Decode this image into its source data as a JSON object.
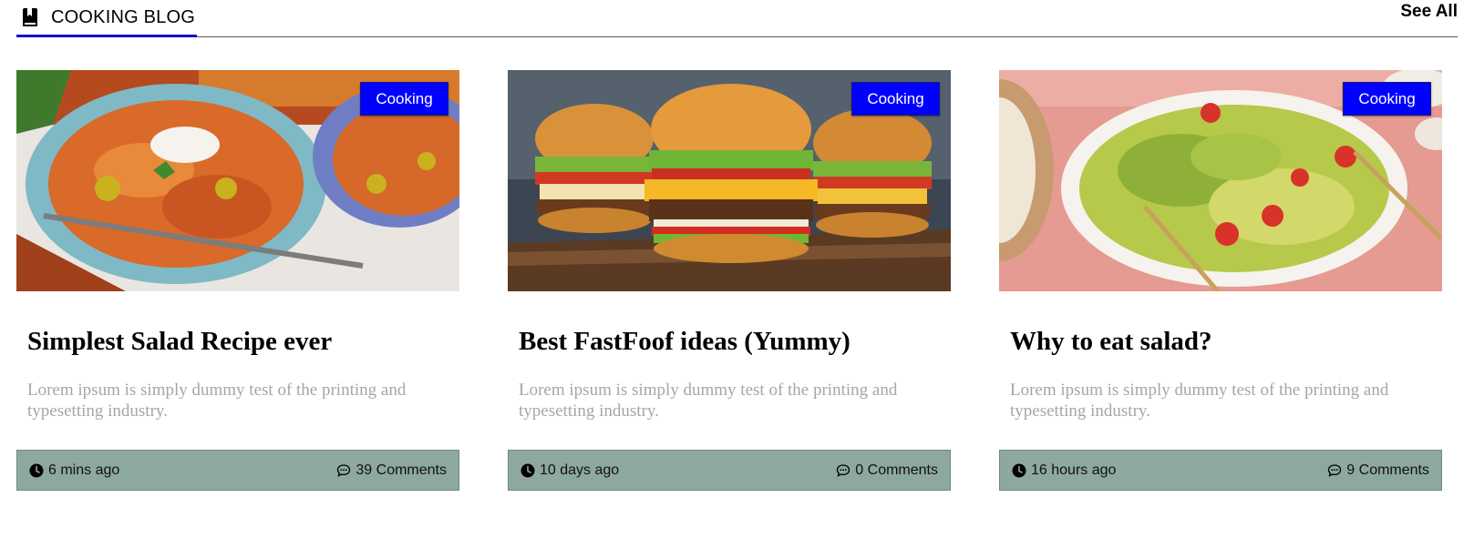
{
  "header": {
    "icon": "book-bookmark-icon",
    "title": "COOKING BLOG",
    "see_all": "See All",
    "accent_color": "#0a14c8"
  },
  "posts": [
    {
      "image": "pasta-bowls-photo",
      "category": "Cooking",
      "title": "Simplest Salad Recipe ever",
      "description": "Lorem ipsum is simply dummy test of the printing and typesetting industry.",
      "time": "6 mins ago",
      "comments": "39 Comments"
    },
    {
      "image": "burgers-photo",
      "category": "Cooking",
      "title": "Best FastFoof ideas (Yummy)",
      "description": "Lorem ipsum is simply dummy test of the printing and typesetting industry.",
      "time": "10 days ago",
      "comments": "0 Comments"
    },
    {
      "image": "salad-bowl-photo",
      "category": "Cooking",
      "title": "Why to eat salad?",
      "description": "Lorem ipsum is simply dummy test of the printing and typesetting industry.",
      "time": "16 hours ago",
      "comments": "9 Comments"
    }
  ],
  "colors": {
    "badge": "#0000ff",
    "footer": "#8da89f",
    "description": "#a6a6a6"
  }
}
